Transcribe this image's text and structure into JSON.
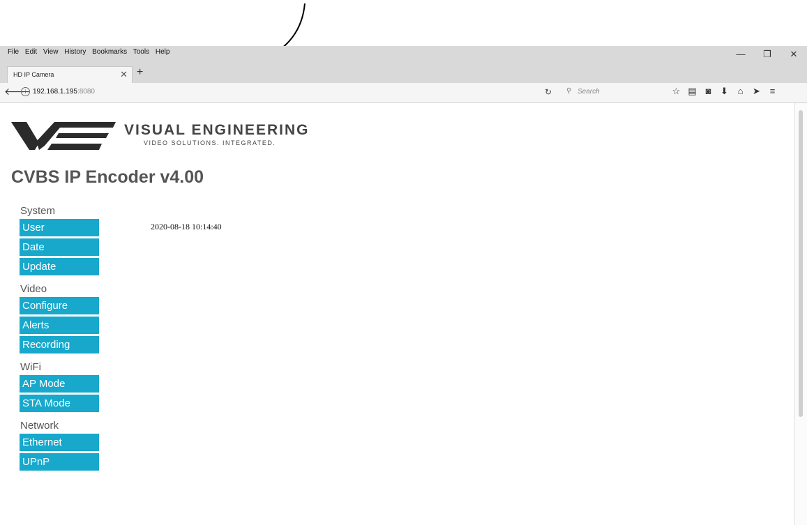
{
  "browser": {
    "menu": [
      "File",
      "Edit",
      "View",
      "History",
      "Bookmarks",
      "Tools",
      "Help"
    ],
    "window_controls": {
      "minimize": "—",
      "restore": "❐",
      "close": "✕"
    },
    "tab": {
      "title": "HD IP Camera",
      "close": "✕"
    },
    "new_tab": "+",
    "address": {
      "host": "192.168.1.195",
      "port": ":8080"
    },
    "search_placeholder": "Search",
    "toolbar_icons": [
      "star-icon",
      "reading-list-icon",
      "pocket-icon",
      "download-icon",
      "home-icon",
      "send-icon",
      "menu-icon"
    ]
  },
  "page": {
    "brand": {
      "name": "VISUAL ENGINEERING",
      "tagline": "VIDEO SOLUTIONS. INTEGRATED."
    },
    "title": "CVBS IP Encoder v4.00",
    "datetime": "2020-08-18 10:14:40",
    "nav": [
      {
        "section": "System",
        "links": [
          "User",
          "Date",
          "Update"
        ]
      },
      {
        "section": "Video",
        "links": [
          "Configure",
          "Alerts",
          "Recording"
        ]
      },
      {
        "section": "WiFi",
        "links": [
          "AP Mode",
          "STA Mode"
        ]
      },
      {
        "section": "Network",
        "links": [
          "Ethernet",
          "UPnP"
        ]
      }
    ]
  },
  "colors": {
    "nav_button": "#17a8cc",
    "title": "#555555"
  }
}
